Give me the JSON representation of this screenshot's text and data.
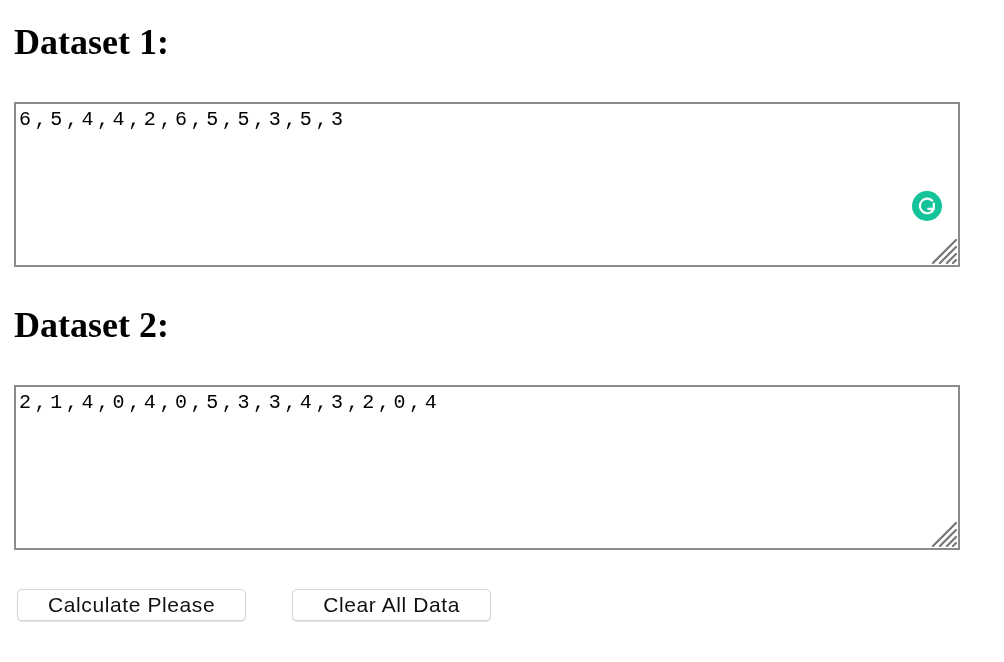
{
  "datasets": [
    {
      "heading": "Dataset 1:",
      "value": "6,5,4,4,2,6,5,5,3,5,3",
      "grammar_badge": true
    },
    {
      "heading": "Dataset 2:",
      "value": "2,1,4,0,4,0,5,3,3,4,3,2,0,4",
      "grammar_badge": false
    }
  ],
  "buttons": [
    "Calculate Please",
    "Clear All Data"
  ]
}
